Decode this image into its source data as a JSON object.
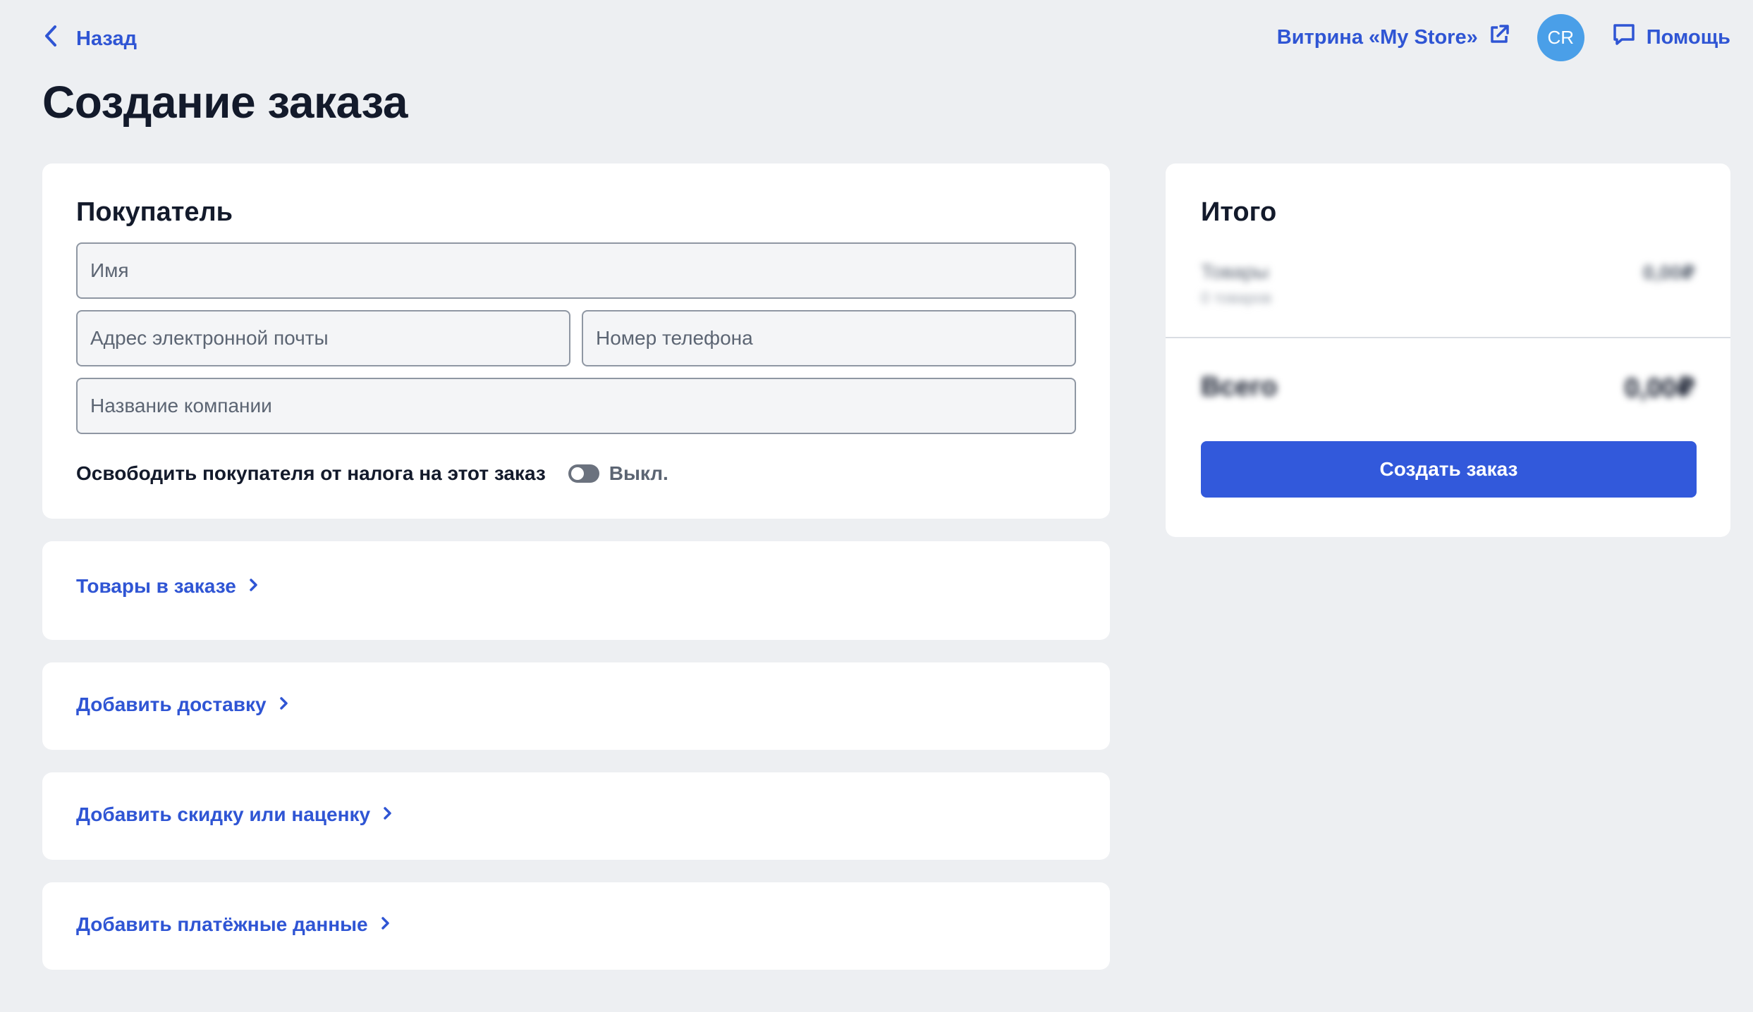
{
  "colors": {
    "accent": "#2f55d4",
    "primary_button": "#3259db",
    "avatar_bg": "#4a9fe8",
    "page_bg": "#edeff2"
  },
  "header": {
    "back_label": "Назад",
    "back_icon": "chevron-left-icon",
    "store_link_label": "Витрина «My Store»",
    "store_link_icon": "external-link-icon",
    "avatar_initials": "CR",
    "help_label": "Помощь",
    "help_icon": "chat-bubble-icon"
  },
  "page_title": "Создание заказа",
  "buyer": {
    "title": "Покупатель",
    "name_placeholder": "Имя",
    "email_placeholder": "Адрес электронной почты",
    "phone_placeholder": "Номер телефона",
    "company_placeholder": "Название компании",
    "tax_exempt_label": "Освободить покупателя от налога на этот заказ",
    "tax_exempt_state": "Выкл."
  },
  "sections": {
    "products": "Товары в заказе",
    "delivery": "Добавить доставку",
    "discount": "Добавить скидку или наценку",
    "payment": "Добавить платёжные данные"
  },
  "summary": {
    "title": "Итого",
    "create_button": "Создать заказ"
  }
}
